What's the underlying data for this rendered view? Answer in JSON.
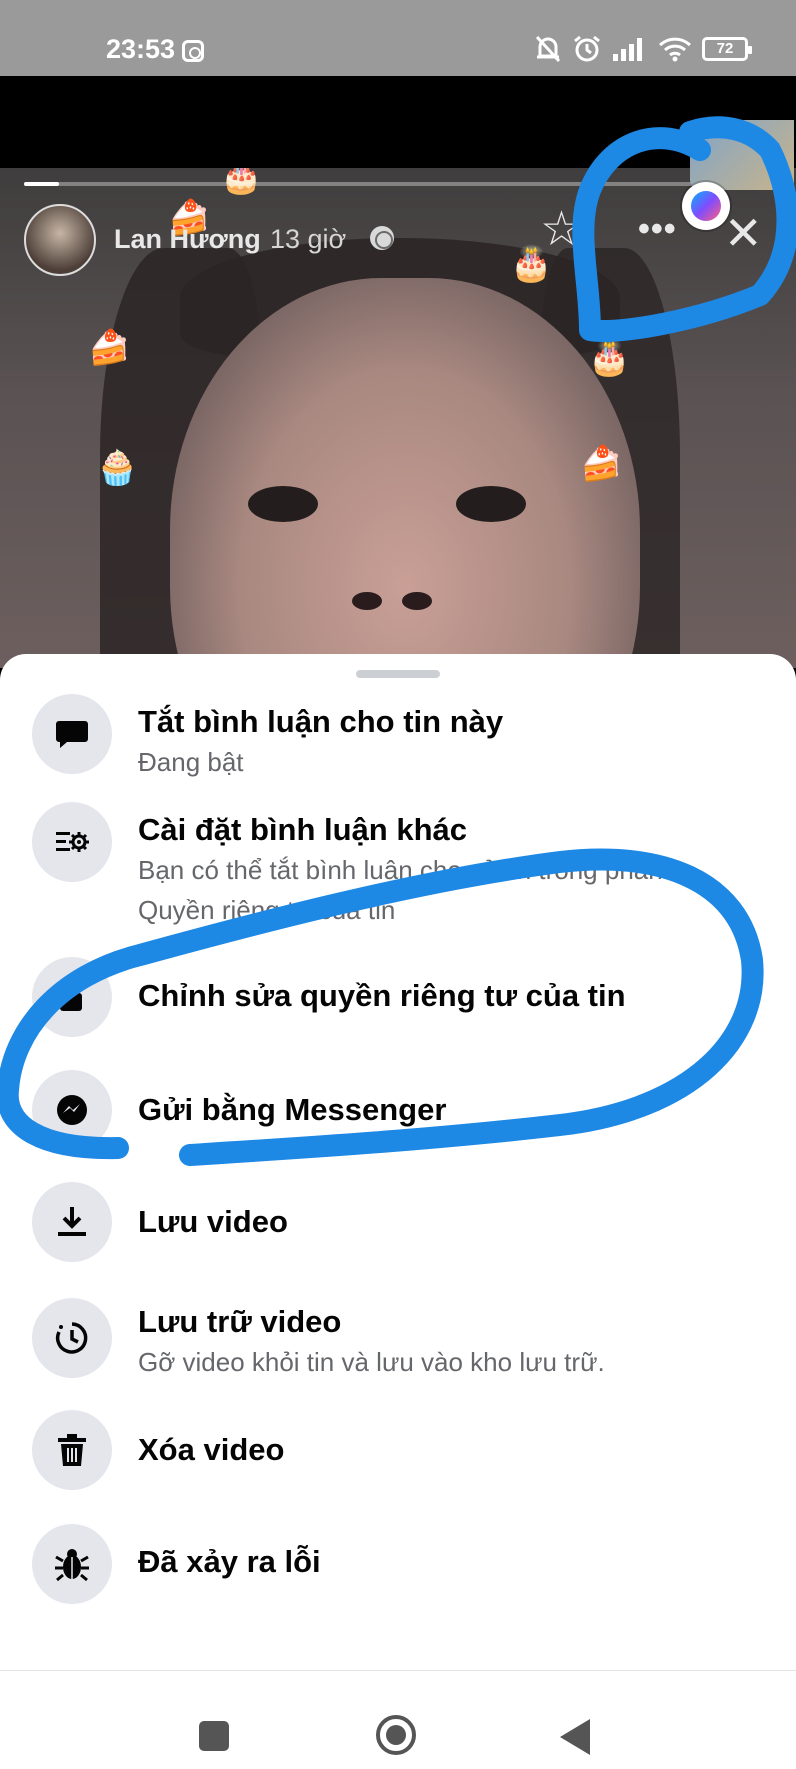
{
  "status_bar": {
    "time": "23:53",
    "battery": "72",
    "icons": [
      "instagram-icon",
      "mute-bell-icon",
      "alarm-icon",
      "signal-icon",
      "wifi-icon",
      "battery-icon"
    ]
  },
  "story": {
    "author": "Lan Hương",
    "time": "13 giờ",
    "progress": 0.05,
    "icons": [
      "globe-icon",
      "star-icon",
      "more-icon",
      "close-icon",
      "messenger-icon"
    ]
  },
  "menu": {
    "items": [
      {
        "title": "Tắt bình luận cho tin này",
        "subtitle": "Đang bật",
        "icon": "comment-icon"
      },
      {
        "title": "Cài đặt bình luận khác",
        "subtitle": "Bạn có thể tắt bình luận cho cả tin trong phần Quyền riêng tư của tin",
        "icon": "settings-list-icon"
      },
      {
        "title": "Chỉnh sửa quyền riêng tư của tin",
        "subtitle": "",
        "icon": "lock-icon"
      },
      {
        "title": "Gửi bằng Messenger",
        "subtitle": "",
        "icon": "messenger-icon"
      },
      {
        "title": "Lưu video",
        "subtitle": "",
        "icon": "download-icon"
      },
      {
        "title": "Lưu trữ video",
        "subtitle": "Gỡ video khỏi tin và lưu vào kho lưu trữ.",
        "icon": "archive-clock-icon"
      },
      {
        "title": "Xóa video",
        "subtitle": "",
        "icon": "trash-icon"
      },
      {
        "title": "Đã xảy ra lỗi",
        "subtitle": "",
        "icon": "bug-icon"
      }
    ]
  },
  "annotation": {
    "color": "#1e88e5"
  },
  "colors": {
    "sheet_bg": "#ffffff",
    "icon_bg": "#e4e6eb",
    "title": "#050505",
    "subtitle": "#65676b"
  }
}
